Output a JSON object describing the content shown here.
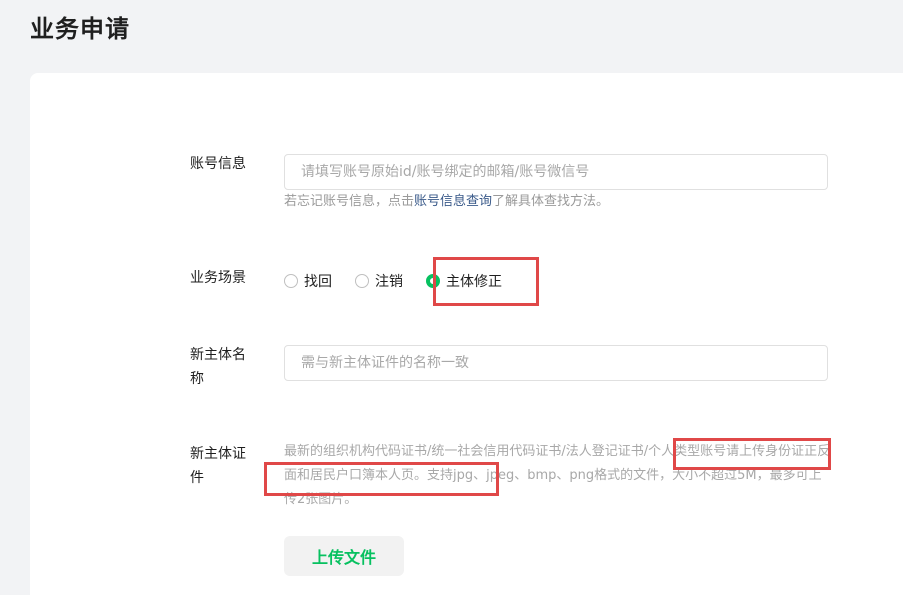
{
  "page": {
    "title": "业务申请"
  },
  "account": {
    "label": "账号信息",
    "placeholder": "请填写账号原始id/账号绑定的邮箱/账号微信号",
    "hint_prefix": "若忘记账号信息，点击",
    "hint_link": "账号信息查询",
    "hint_suffix": "了解具体查找方法。"
  },
  "scene": {
    "label": "业务场景",
    "options": [
      {
        "label": "找回",
        "checked": false
      },
      {
        "label": "注销",
        "checked": false
      },
      {
        "label": "主体修正",
        "checked": true
      }
    ]
  },
  "new_name": {
    "label": "新主体名称",
    "placeholder": "需与新主体证件的名称一致"
  },
  "new_cert": {
    "label": "新主体证件",
    "hint": "最新的组织机构代码证书/统一社会信用代码证书/法人登记证书/个人类型账号请上传身份证正反面和居民户口簿本人页。支持jpg、jpeg、bmp、png格式的文件，大小不超过5M，最多可上传2张图片。",
    "upload_label": "上传文件"
  },
  "colors": {
    "accent": "#07c160",
    "highlight": "#e04848",
    "link": "#3a5a8a"
  }
}
